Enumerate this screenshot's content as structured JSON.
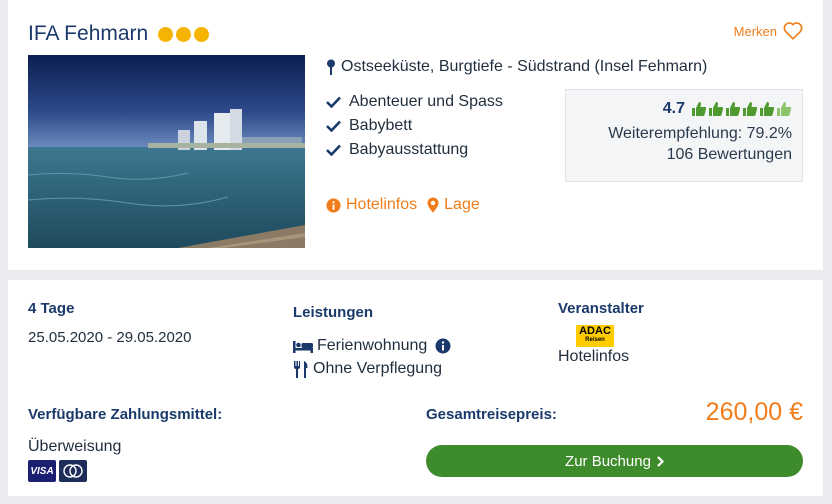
{
  "hotel": {
    "name": "IFA Fehmarn",
    "star_count": 3,
    "save_label": "Merken",
    "location": "Ostseeküste, Burgtiefe - Südstrand (Insel Fehmarn)",
    "features": [
      "Abenteuer und Spass",
      "Babybett",
      "Babyausstattung"
    ],
    "links": {
      "hotelinfos": "Hotelinfos",
      "lage": "Lage"
    }
  },
  "rating": {
    "score": "4.7",
    "thumbs_full": 6,
    "thumbs_total": 6,
    "recommendation": "Weiterempfehlung: 79.2%",
    "reviews": "106 Bewertungen"
  },
  "offer": {
    "duration": "4 Tage",
    "dates": "25.05.2020 - 29.05.2020",
    "services_label": "Leistungen",
    "room": "Ferienwohnung",
    "board": "Ohne Verpflegung",
    "operator_label": "Veranstalter",
    "operator_logo": {
      "main": "ADAC",
      "sub": "Reisen"
    },
    "operator_link": "Hotelinfos",
    "payment_label": "Verfügbare Zahlungsmittel:",
    "payment_method": "Überweisung",
    "payment_card_visa": "VISA",
    "total_label": "Gesamtreisepreis:",
    "price": "260,00 €",
    "book_label": "Zur Buchung"
  },
  "colors": {
    "accent_orange": "#f07d1a",
    "title_blue": "#1b3a6b",
    "book_green": "#3e8b2c",
    "star_gold": "#f5b400",
    "thumb_green": "#4e9a2e"
  }
}
